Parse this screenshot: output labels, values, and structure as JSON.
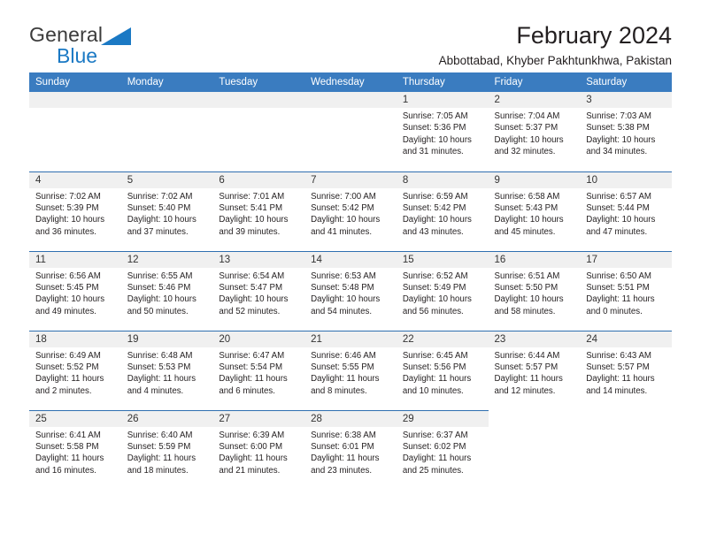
{
  "brand": {
    "name_top": "General",
    "name_bottom": "Blue",
    "triangle_color": "#1b79c4",
    "text_color": "#3b3b3b"
  },
  "header": {
    "title": "February 2024",
    "subtitle": "Abbottabad, Khyber Pakhtunkhwa, Pakistan"
  },
  "theme": {
    "header_row_bg": "#3a7cc0",
    "header_row_text": "#ffffff",
    "daynum_band_bg": "#f0f0f0",
    "week_rule": "#2f6fb0",
    "body_text": "#231f20"
  },
  "weekday_headers": [
    "Sunday",
    "Monday",
    "Tuesday",
    "Wednesday",
    "Thursday",
    "Friday",
    "Saturday"
  ],
  "weeks": [
    [
      {
        "day": "",
        "lines": []
      },
      {
        "day": "",
        "lines": []
      },
      {
        "day": "",
        "lines": []
      },
      {
        "day": "",
        "lines": []
      },
      {
        "day": "1",
        "lines": [
          "Sunrise: 7:05 AM",
          "Sunset: 5:36 PM",
          "Daylight: 10 hours",
          "and 31 minutes."
        ]
      },
      {
        "day": "2",
        "lines": [
          "Sunrise: 7:04 AM",
          "Sunset: 5:37 PM",
          "Daylight: 10 hours",
          "and 32 minutes."
        ]
      },
      {
        "day": "3",
        "lines": [
          "Sunrise: 7:03 AM",
          "Sunset: 5:38 PM",
          "Daylight: 10 hours",
          "and 34 minutes."
        ]
      }
    ],
    [
      {
        "day": "4",
        "lines": [
          "Sunrise: 7:02 AM",
          "Sunset: 5:39 PM",
          "Daylight: 10 hours",
          "and 36 minutes."
        ]
      },
      {
        "day": "5",
        "lines": [
          "Sunrise: 7:02 AM",
          "Sunset: 5:40 PM",
          "Daylight: 10 hours",
          "and 37 minutes."
        ]
      },
      {
        "day": "6",
        "lines": [
          "Sunrise: 7:01 AM",
          "Sunset: 5:41 PM",
          "Daylight: 10 hours",
          "and 39 minutes."
        ]
      },
      {
        "day": "7",
        "lines": [
          "Sunrise: 7:00 AM",
          "Sunset: 5:42 PM",
          "Daylight: 10 hours",
          "and 41 minutes."
        ]
      },
      {
        "day": "8",
        "lines": [
          "Sunrise: 6:59 AM",
          "Sunset: 5:42 PM",
          "Daylight: 10 hours",
          "and 43 minutes."
        ]
      },
      {
        "day": "9",
        "lines": [
          "Sunrise: 6:58 AM",
          "Sunset: 5:43 PM",
          "Daylight: 10 hours",
          "and 45 minutes."
        ]
      },
      {
        "day": "10",
        "lines": [
          "Sunrise: 6:57 AM",
          "Sunset: 5:44 PM",
          "Daylight: 10 hours",
          "and 47 minutes."
        ]
      }
    ],
    [
      {
        "day": "11",
        "lines": [
          "Sunrise: 6:56 AM",
          "Sunset: 5:45 PM",
          "Daylight: 10 hours",
          "and 49 minutes."
        ]
      },
      {
        "day": "12",
        "lines": [
          "Sunrise: 6:55 AM",
          "Sunset: 5:46 PM",
          "Daylight: 10 hours",
          "and 50 minutes."
        ]
      },
      {
        "day": "13",
        "lines": [
          "Sunrise: 6:54 AM",
          "Sunset: 5:47 PM",
          "Daylight: 10 hours",
          "and 52 minutes."
        ]
      },
      {
        "day": "14",
        "lines": [
          "Sunrise: 6:53 AM",
          "Sunset: 5:48 PM",
          "Daylight: 10 hours",
          "and 54 minutes."
        ]
      },
      {
        "day": "15",
        "lines": [
          "Sunrise: 6:52 AM",
          "Sunset: 5:49 PM",
          "Daylight: 10 hours",
          "and 56 minutes."
        ]
      },
      {
        "day": "16",
        "lines": [
          "Sunrise: 6:51 AM",
          "Sunset: 5:50 PM",
          "Daylight: 10 hours",
          "and 58 minutes."
        ]
      },
      {
        "day": "17",
        "lines": [
          "Sunrise: 6:50 AM",
          "Sunset: 5:51 PM",
          "Daylight: 11 hours",
          "and 0 minutes."
        ]
      }
    ],
    [
      {
        "day": "18",
        "lines": [
          "Sunrise: 6:49 AM",
          "Sunset: 5:52 PM",
          "Daylight: 11 hours",
          "and 2 minutes."
        ]
      },
      {
        "day": "19",
        "lines": [
          "Sunrise: 6:48 AM",
          "Sunset: 5:53 PM",
          "Daylight: 11 hours",
          "and 4 minutes."
        ]
      },
      {
        "day": "20",
        "lines": [
          "Sunrise: 6:47 AM",
          "Sunset: 5:54 PM",
          "Daylight: 11 hours",
          "and 6 minutes."
        ]
      },
      {
        "day": "21",
        "lines": [
          "Sunrise: 6:46 AM",
          "Sunset: 5:55 PM",
          "Daylight: 11 hours",
          "and 8 minutes."
        ]
      },
      {
        "day": "22",
        "lines": [
          "Sunrise: 6:45 AM",
          "Sunset: 5:56 PM",
          "Daylight: 11 hours",
          "and 10 minutes."
        ]
      },
      {
        "day": "23",
        "lines": [
          "Sunrise: 6:44 AM",
          "Sunset: 5:57 PM",
          "Daylight: 11 hours",
          "and 12 minutes."
        ]
      },
      {
        "day": "24",
        "lines": [
          "Sunrise: 6:43 AM",
          "Sunset: 5:57 PM",
          "Daylight: 11 hours",
          "and 14 minutes."
        ]
      }
    ],
    [
      {
        "day": "25",
        "lines": [
          "Sunrise: 6:41 AM",
          "Sunset: 5:58 PM",
          "Daylight: 11 hours",
          "and 16 minutes."
        ]
      },
      {
        "day": "26",
        "lines": [
          "Sunrise: 6:40 AM",
          "Sunset: 5:59 PM",
          "Daylight: 11 hours",
          "and 18 minutes."
        ]
      },
      {
        "day": "27",
        "lines": [
          "Sunrise: 6:39 AM",
          "Sunset: 6:00 PM",
          "Daylight: 11 hours",
          "and 21 minutes."
        ]
      },
      {
        "day": "28",
        "lines": [
          "Sunrise: 6:38 AM",
          "Sunset: 6:01 PM",
          "Daylight: 11 hours",
          "and 23 minutes."
        ]
      },
      {
        "day": "29",
        "lines": [
          "Sunrise: 6:37 AM",
          "Sunset: 6:02 PM",
          "Daylight: 11 hours",
          "and 25 minutes."
        ]
      },
      {
        "day": "",
        "lines": []
      },
      {
        "day": "",
        "lines": []
      }
    ]
  ]
}
